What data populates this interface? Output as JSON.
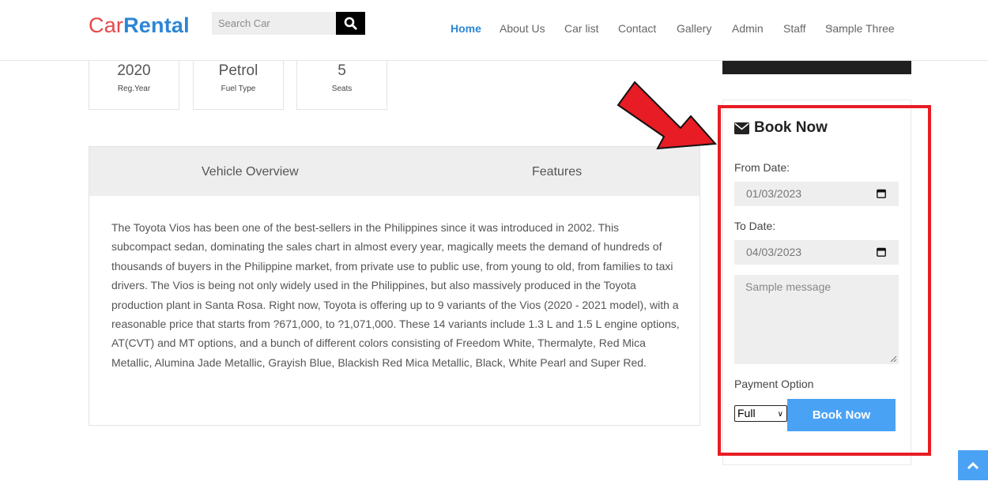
{
  "brand": {
    "part1": "Car",
    "part2": "Rental"
  },
  "search": {
    "placeholder": "Search Car",
    "icon": "search-icon"
  },
  "nav": {
    "items": [
      {
        "label": "Home",
        "active": true
      },
      {
        "label": "About Us"
      },
      {
        "label": "Car list"
      },
      {
        "label": "Contact"
      },
      {
        "label": "Gallery"
      },
      {
        "label": "Admin"
      },
      {
        "label": "Staff"
      },
      {
        "label": "Sample Three",
        "dropdown": true
      }
    ]
  },
  "stats": [
    {
      "value": "2020",
      "label": "Reg.Year"
    },
    {
      "value": "Petrol",
      "label": "Fuel Type"
    },
    {
      "value": "5",
      "label": "Seats"
    }
  ],
  "tabs": {
    "overview": "Vehicle Overview",
    "features": "Features"
  },
  "description": "The Toyota Vios has been one of the best-sellers in the Philippines since it was introduced in 2002. This subcompact sedan, dominating the sales chart in almost every year, magically meets the demand of hundreds of thousands of buyers in the Philippine market, from private use to public use, from young to old, from families to taxi drivers. The Vios is being not only widely used in the Philippines, but also massively produced in the Toyota production plant in Santa Rosa. Right now, Toyota is offering up to 9 variants of the Vios (2020 - 2021 model), with a reasonable price that starts from ?671,000, to ?1,071,000. These 14 variants include 1.3 L and 1.5 L engine options, AT(CVT) and MT options, and a bunch of different colors consisting of Freedom White, Thermalyte, Red Mica Metallic, Alumina Jade Metallic, Grayish Blue, Blackish Red Mica Metallic, Black, White Pearl and Super Red.",
  "booking": {
    "title": "Book Now",
    "from_label": "From Date:",
    "from_value": "01/03/2023",
    "to_label": "To Date:",
    "to_value": "04/03/2023",
    "message_placeholder": "Sample message",
    "payment_label": "Payment Option",
    "payment_value": "Full",
    "submit_label": "Book Now"
  },
  "colors": {
    "brand_red": "#e8474a",
    "brand_blue": "#2c86d6",
    "button_blue": "#4aa2f5",
    "highlight_red": "#e81c24"
  }
}
